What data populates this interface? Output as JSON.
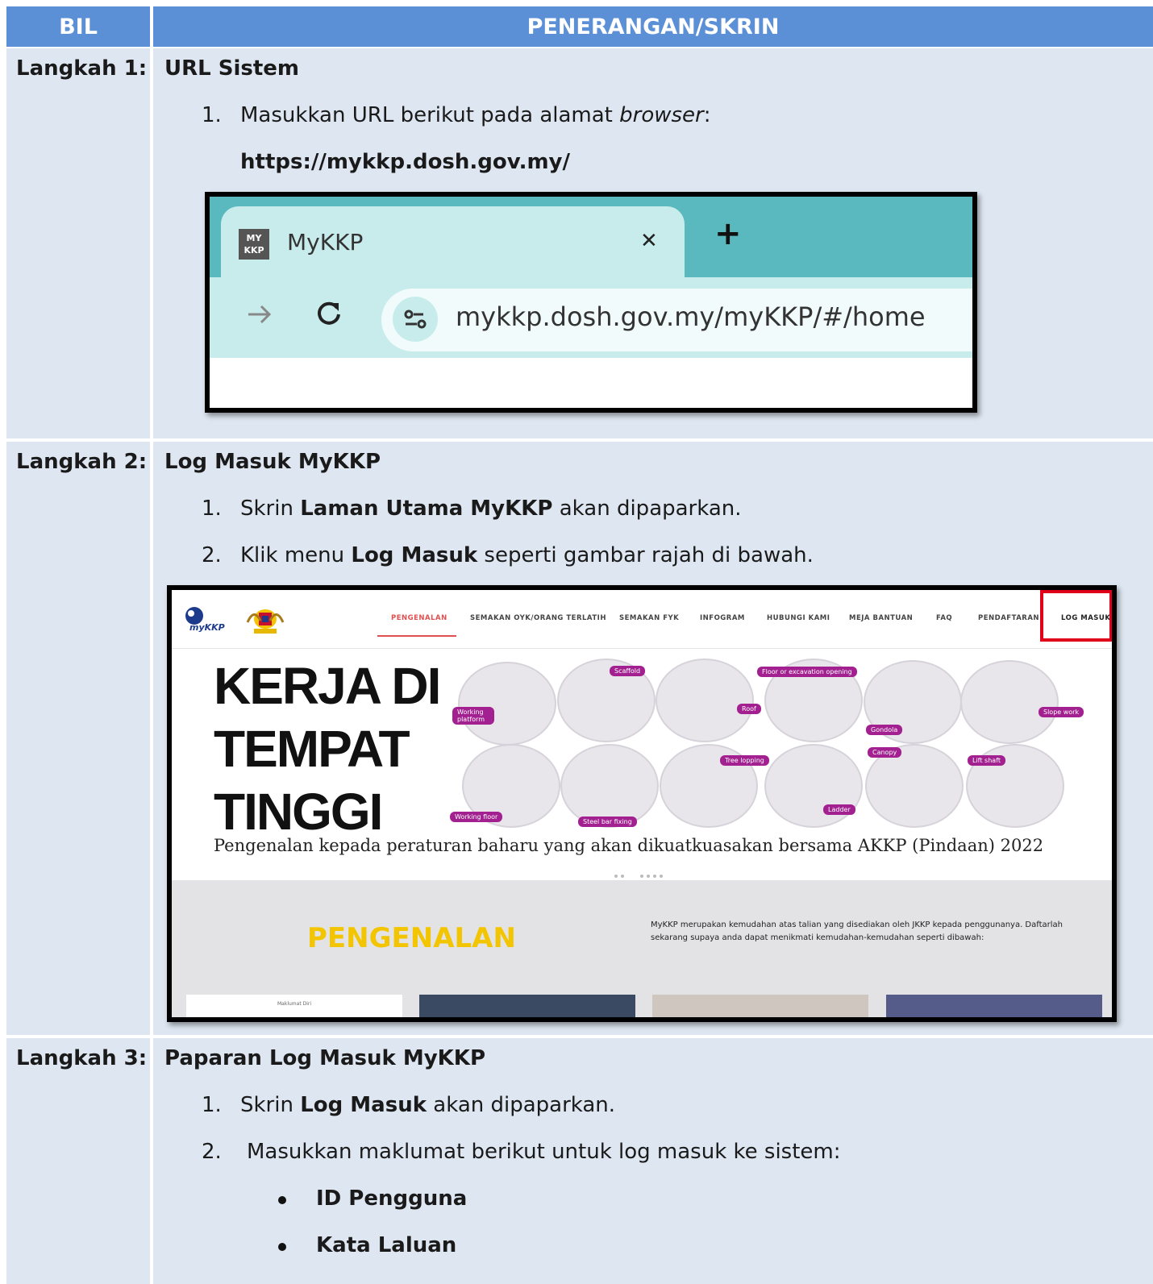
{
  "header": {
    "col1": "BIL",
    "col2": "PENERANGAN/SKRIN"
  },
  "steps": [
    {
      "label": "Langkah 1:",
      "title": "URL Sistem",
      "item1_num": "1.",
      "item1_prefix": "Masukkan URL berikut pada alamat ",
      "item1_italic": "browser",
      "item1_suffix": ":",
      "url_text": "https://mykkp.dosh.gov.my/",
      "browser": {
        "tab_title": "MyKKP",
        "favicon_line1": "MY",
        "favicon_line2": "KKP",
        "close_glyph": "✕",
        "new_tab_glyph": "+",
        "address": "mykkp.dosh.gov.my/myKKP/#/home"
      }
    },
    {
      "label": "Langkah 2:",
      "title": "Log Masuk MyKKP",
      "item1_num": "1.",
      "item1_pre": "Skrin ",
      "item1_bold": "Laman Utama MyKKP",
      "item1_post": " akan dipaparkan.",
      "item2_num": "2.",
      "item2_pre": "Klik menu ",
      "item2_bold": "Log Masuk",
      "item2_post": " seperti gambar rajah di bawah.",
      "site": {
        "logo_text": "myKKP",
        "nav": [
          "PENGENALAN",
          "SEMAKAN OYK/ORANG TERLATIH",
          "SEMAKAN FYK",
          "INFOGRAM",
          "HUBUNGI KAMI",
          "MEJA BANTUAN",
          "FAQ",
          "PENDAFTARAN",
          "LOG MASUK"
        ],
        "banner_line1": "KERJA DI",
        "banner_line2": "TEMPAT",
        "banner_line3": "TINGGI",
        "tags": [
          "Working platform",
          "Scaffold",
          "Roof",
          "Floor or excavation opening",
          "Gondola",
          "Slope work",
          "Working floor",
          "Steel bar fixing",
          "Tree lopping",
          "Ladder",
          "Canopy",
          "Lift shaft"
        ],
        "banner_caption": "Pengenalan kepada peraturan baharu yang akan dikuatkuasakan bersama AKKP (Pindaan) 2022",
        "section_title": "PENGENALAN",
        "section_text": "MyKKP merupakan kemudahan atas talian yang disediakan oleh JKKP kepada penggunanya. Daftarlah sekarang supaya anda dapat menikmati kemudahan-kemudahan seperti dibawah:",
        "card1_title": "Maklumat Diri"
      }
    },
    {
      "label": "Langkah 3:",
      "title": "Paparan Log Masuk MyKKP",
      "item1_num": "1.",
      "item1_pre": "Skrin ",
      "item1_bold": "Log Masuk",
      "item1_post": " akan dipaparkan.",
      "item2_num": "2.",
      "item2_text": "Masukkan maklumat berikut untuk log masuk ke sistem:",
      "bullets": [
        "ID Pengguna",
        "Kata Laluan"
      ]
    }
  ],
  "colors": {
    "header": "#5b8fd6",
    "cell": "#dde6f1",
    "highlight": "#e0001a",
    "tag": "#a2208f",
    "section_title": "#f2c500"
  }
}
